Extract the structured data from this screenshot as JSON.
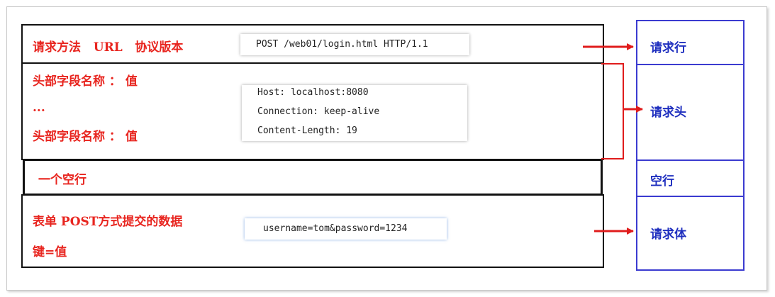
{
  "left": {
    "request_line_label": "请求方法   URL   协议版本",
    "header_label_1": "头部字段名称 ： 值",
    "ellipsis": "...",
    "header_label_2": "头部字段名称 ： 值",
    "blank_label": "一个空行",
    "body_label": "表单 POST方式提交的数据",
    "body_kv": "键=值"
  },
  "code": {
    "request_line": "POST /web01/login.html HTTP/1.1",
    "headers": [
      "Host: localhost:8080",
      "Connection: keep-alive",
      "Content-Length: 19"
    ],
    "body": "username=tom&password=1234"
  },
  "right": {
    "request_line": "请求行",
    "request_header": "请求头",
    "blank_line": "空行",
    "request_body": "请求体"
  },
  "colors": {
    "red": "#e8251f",
    "blue": "#3b3bd0",
    "black": "#111111",
    "arrow": "#e01c1c"
  }
}
